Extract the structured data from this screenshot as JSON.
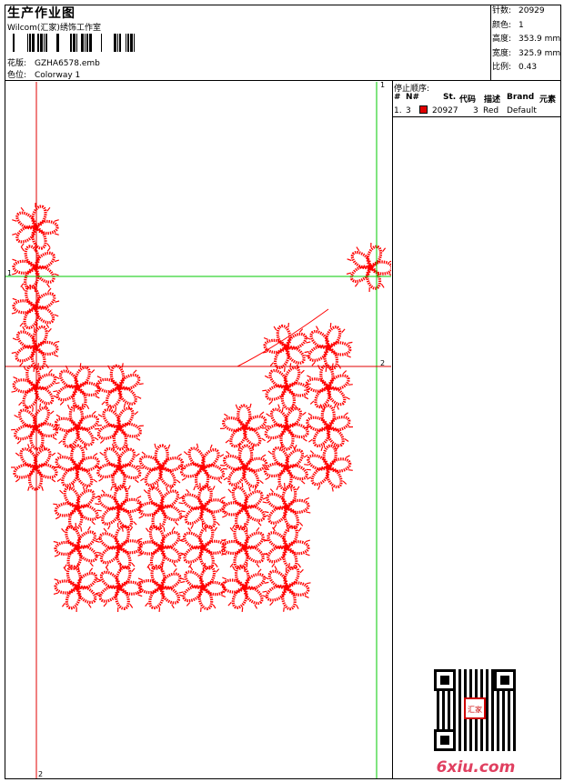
{
  "header": {
    "title": "生产作业图",
    "subtitle": "Wilcom(汇家)绣饰工作室",
    "design_label": "花版:",
    "design_value": "GZHA6578.emb",
    "colorway_label": "色位:",
    "colorway_value": "Colorway 1"
  },
  "stats": {
    "stitches_label": "针数:",
    "stitches_value": "20929",
    "colors_label": "颜色:",
    "colors_value": "1",
    "height_label": "高度:",
    "height_value": "353.9 mm",
    "width_label": "宽度:",
    "width_value": "325.9 mm",
    "scale_label": "比例:",
    "scale_value": "0.43"
  },
  "stop_sequence": {
    "title": "停止顺序:",
    "columns": [
      "#",
      "N#",
      "St.",
      "代码",
      "描述",
      "Brand",
      "元素"
    ],
    "rows": [
      {
        "index": "1.",
        "needle": "3",
        "color": "#e00000",
        "stitches": "20927",
        "code": "3",
        "description": "Red",
        "brand": "Default"
      }
    ]
  },
  "guides": {
    "left_top": "1",
    "right_top": "1",
    "right_mid": "2",
    "bottom_left": "2"
  },
  "colors": {
    "thread": "#ff0000",
    "guide_green": "#00c800",
    "guide_red": "#e00000"
  },
  "watermark": {
    "logo_text": "6xiu.com",
    "stamp_text": "汇家"
  }
}
